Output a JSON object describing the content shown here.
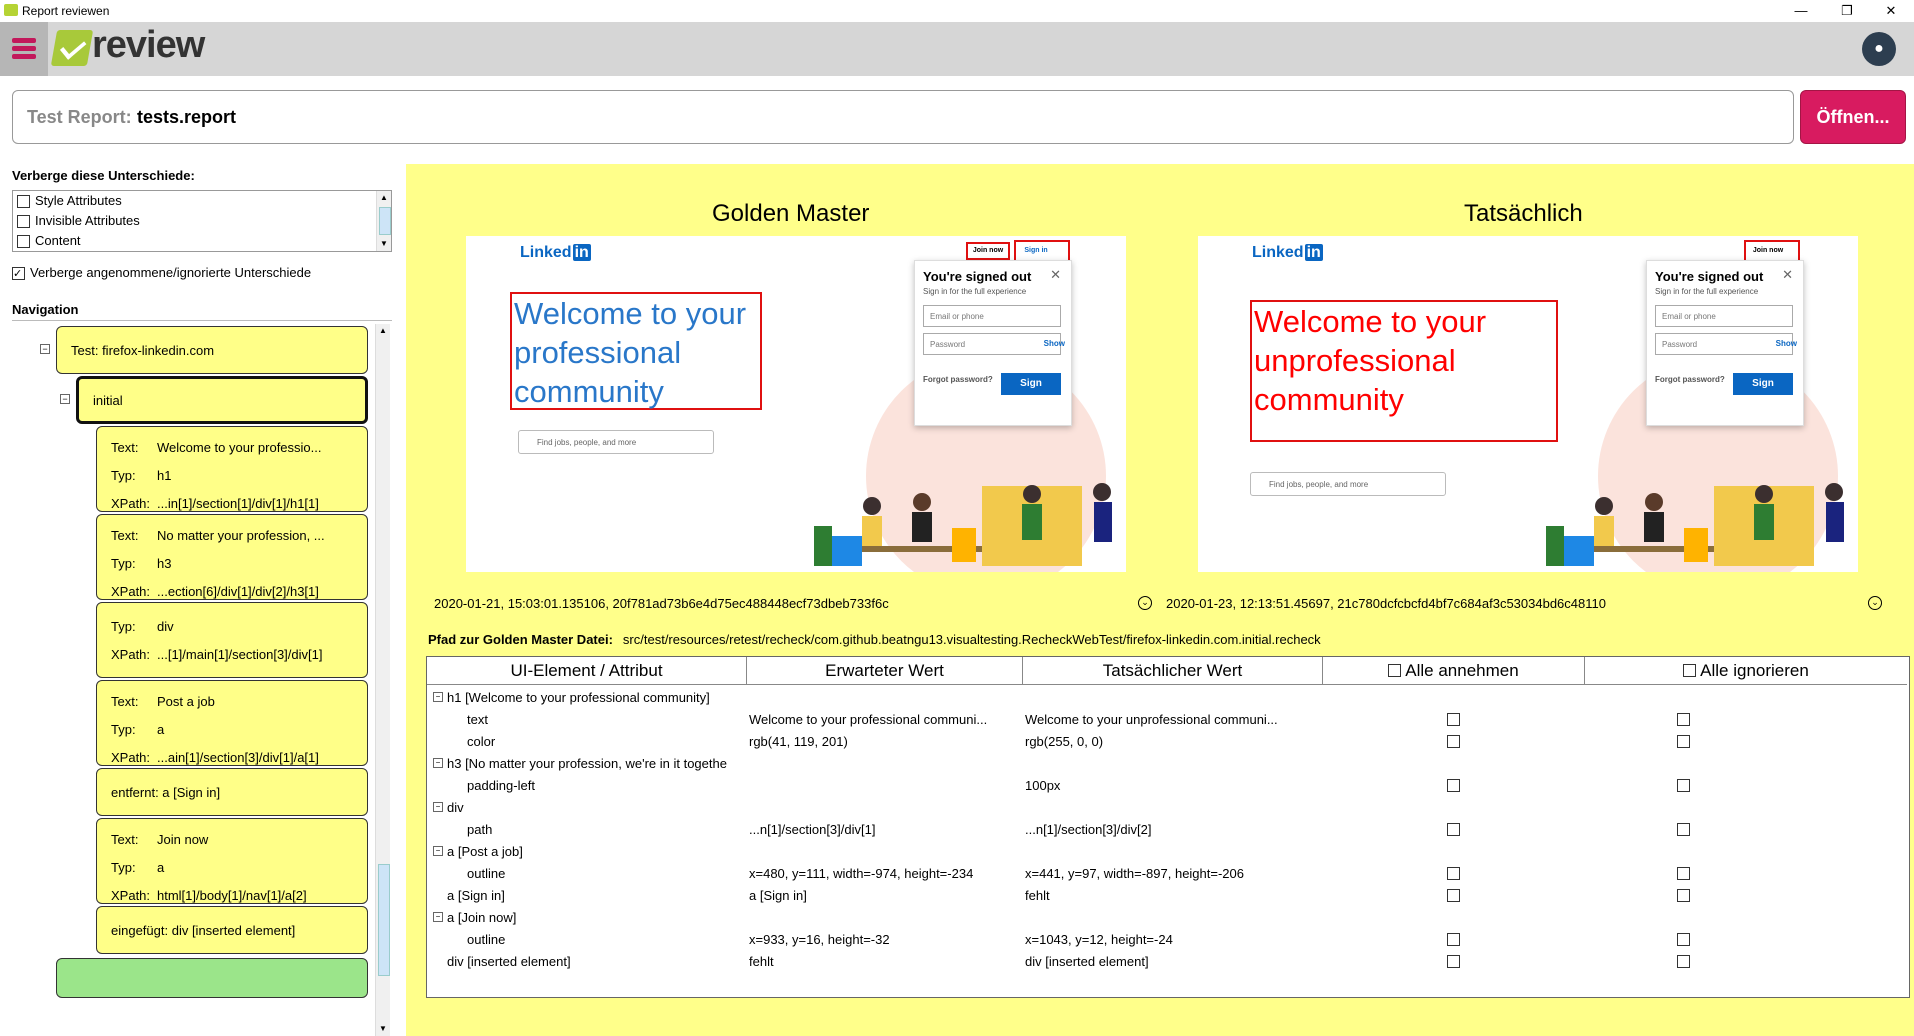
{
  "window": {
    "title": "Report reviewen",
    "minimize": "—",
    "restore": "❐",
    "close": "✕"
  },
  "app": {
    "logo_text": "review"
  },
  "report": {
    "label": "Test Report:",
    "value": "tests.report",
    "open_button": "Öffnen..."
  },
  "filters": {
    "title": "Verberge diese Unterschiede:",
    "items": [
      {
        "label": "Style Attributes",
        "checked": false
      },
      {
        "label": "Invisible Attributes",
        "checked": false
      },
      {
        "label": "Content",
        "checked": false
      }
    ],
    "hide_accepted": {
      "label": "Verberge angenommene/ignorierte Unterschiede",
      "checked": true
    }
  },
  "navigation": {
    "title": "Navigation",
    "test": "Test: firefox-linkedin.com",
    "state": "initial",
    "nodes": [
      {
        "lines": [
          [
            "Text:",
            "Welcome to your professio..."
          ],
          [
            "Typ:",
            "h1"
          ],
          [
            "XPath:",
            "...in[1]/section[1]/div[1]/h1[1]"
          ]
        ]
      },
      {
        "lines": [
          [
            "Text:",
            "No matter your profession, ..."
          ],
          [
            "Typ:",
            "h3"
          ],
          [
            "XPath:",
            "...ection[6]/div[1]/div[2]/h3[1]"
          ]
        ]
      },
      {
        "lines": [
          [
            "Typ:",
            "div"
          ],
          [
            "XPath:",
            "...[1]/main[1]/section[3]/div[1]"
          ]
        ]
      },
      {
        "lines": [
          [
            "Text:",
            "Post a job"
          ],
          [
            "Typ:",
            "a"
          ],
          [
            "XPath:",
            "...ain[1]/section[3]/div[1]/a[1]"
          ]
        ]
      },
      {
        "single": "entfernt: a [Sign in]"
      },
      {
        "lines": [
          [
            "Text:",
            "Join now"
          ],
          [
            "Typ:",
            "a"
          ],
          [
            "XPath:",
            "html[1]/body[1]/nav[1]/a[2]"
          ]
        ]
      },
      {
        "single": "eingefügt: div [inserted element]"
      }
    ]
  },
  "compare": {
    "golden_title": "Golden Master",
    "actual_title": "Tatsächlich",
    "golden_meta": "2020-01-21, 15:03:01.135106, 20f781ad73b6e4d75ec488448ecf73dbeb733f6c",
    "actual_meta": "2020-01-23, 12:13:51.45697, 21c780dcfcbcfd4bf7c684af3c53034bd6c48110",
    "path_label": "Pfad zur Golden Master Datei:",
    "path_value": "src/test/resources/retest/recheck/com.github.beatngu13.visualtesting.RecheckWebTest/firefox-linkedin.com.initial.recheck",
    "golden_shot": {
      "logo": "Linked",
      "logo_in": "in",
      "join": "Join now",
      "sign": "Sign in",
      "headline": [
        "Welcome to your",
        "professional",
        "community"
      ],
      "headline_color": "#2977c9",
      "search": "Find jobs, people, and more",
      "card_title": "You're signed out",
      "card_sub": "Sign in for the full experience",
      "email": "Email or phone",
      "password": "Password",
      "show": "Show",
      "forgot": "Forgot password?",
      "sign_btn": "Sign"
    },
    "actual_shot": {
      "logo": "Linked",
      "logo_in": "in",
      "join": "Join now",
      "headline": [
        "Welcome to your",
        "unprofessional",
        "community"
      ],
      "headline_color": "#ff0000",
      "search": "Find jobs, people, and more",
      "card_title": "You're signed out",
      "card_sub": "Sign in for the full experience",
      "email": "Email or phone",
      "password": "Password",
      "show": "Show",
      "forgot": "Forgot password?",
      "sign_btn": "Sign"
    }
  },
  "table": {
    "headers": [
      "UI-Element / Attribut",
      "Erwarteter Wert",
      "Tatsächlicher Wert",
      "Alle annehmen",
      "Alle ignorieren"
    ],
    "rows": [
      {
        "toggle": true,
        "name": "h1 [Welcome to your professional community]",
        "expected": "",
        "actual": "",
        "boxes": false
      },
      {
        "name": "text",
        "indent": true,
        "expected": "Welcome to your professional communi...",
        "actual": "Welcome to your unprofessional communi...",
        "boxes": true
      },
      {
        "name": "color",
        "indent": true,
        "expected": "rgb(41, 119, 201)",
        "actual": "rgb(255, 0, 0)",
        "boxes": true
      },
      {
        "toggle": true,
        "name": "h3 [No matter your profession, we're in it togethe",
        "expected": "",
        "actual": "",
        "boxes": false
      },
      {
        "name": "padding-left",
        "indent": true,
        "expected": "",
        "actual": "100px",
        "boxes": true
      },
      {
        "toggle": true,
        "name": "div",
        "expected": "",
        "actual": "",
        "boxes": false
      },
      {
        "name": "path",
        "indent": true,
        "expected": "...n[1]/section[3]/div[1]",
        "actual": "...n[1]/section[3]/div[2]",
        "boxes": true
      },
      {
        "toggle": true,
        "name": "a [Post a job]",
        "expected": "",
        "actual": "",
        "boxes": false
      },
      {
        "name": "outline",
        "indent": true,
        "expected": "x=480, y=111, width=-974, height=-234",
        "actual": "x=441, y=97, width=-897, height=-206",
        "boxes": true
      },
      {
        "name": "a [Sign in]",
        "expected": "a [Sign in]",
        "actual": "fehlt",
        "boxes": true
      },
      {
        "toggle": true,
        "name": "a [Join now]",
        "expected": "",
        "actual": "",
        "boxes": false
      },
      {
        "name": "outline",
        "indent": true,
        "expected": "x=933, y=16, height=-32",
        "actual": "x=1043, y=12, height=-24",
        "boxes": true
      },
      {
        "name": "div [inserted element]",
        "expected": "fehlt",
        "actual": "div [inserted element]",
        "boxes": true
      }
    ]
  }
}
